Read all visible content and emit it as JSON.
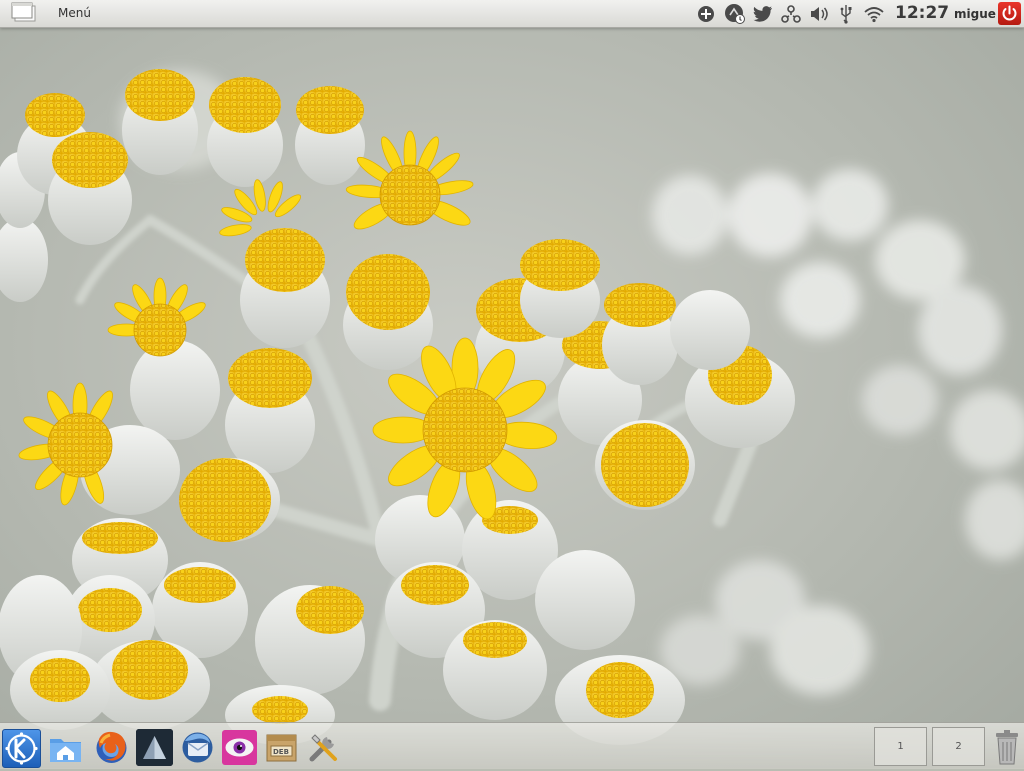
{
  "top_panel": {
    "menu_label": "Menú",
    "clock": "12:27",
    "user": "migue"
  },
  "tray_icons": [
    "add-icon",
    "kde-connect-icon",
    "twitter-icon",
    "network-share-icon",
    "volume-icon",
    "usb-icon",
    "wifi-icon"
  ],
  "launchers": [
    "kde-menu-icon",
    "home-folder-icon",
    "firefox-icon",
    "prism-app-icon",
    "thunderbird-icon",
    "eye-app-icon",
    "deb-package-icon",
    "system-settings-tools-icon"
  ],
  "deb_label": "DEB",
  "pager": {
    "desktop1": "1",
    "desktop2": "2"
  },
  "colors": {
    "accent_yellow": "#f5c518",
    "petal_white": "#eceeec",
    "power_red": "#d0281d",
    "kde_blue": "#2b70d0"
  }
}
